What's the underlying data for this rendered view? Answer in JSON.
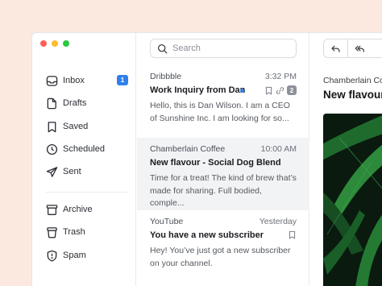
{
  "window_controls": {
    "close_color": "#ff5f57",
    "minimize_color": "#febc2e",
    "maximize_color": "#28c840"
  },
  "sidebar": {
    "items": [
      {
        "label": "Inbox",
        "icon": "inbox-icon",
        "badge": "1"
      },
      {
        "label": "Drafts",
        "icon": "drafts-icon"
      },
      {
        "label": "Saved",
        "icon": "bookmark-icon"
      },
      {
        "label": "Scheduled",
        "icon": "clock-icon"
      },
      {
        "label": "Sent",
        "icon": "send-icon"
      },
      {
        "label": "Archive",
        "icon": "archive-icon"
      },
      {
        "label": "Trash",
        "icon": "trash-icon"
      },
      {
        "label": "Spam",
        "icon": "shield-icon"
      }
    ]
  },
  "search": {
    "placeholder": "Search"
  },
  "messages": [
    {
      "sender": "Dribbble",
      "time": "3:32 PM",
      "subject": "Work Inquiry from Dan",
      "preview": "Hello, this is Dan Wilson. I am a CEO of Sunshine Inc. I am looking for so...",
      "unread": true,
      "attachment_count": "2",
      "icons": [
        "bookmark-icon",
        "link-icon"
      ]
    },
    {
      "sender": "Chamberlain Coffee",
      "time": "10:00 AM",
      "subject": "New flavour - Social Dog Blend",
      "preview": "Time for a treat! The kind of brew that’s made for sharing. Full bodied, comple...",
      "selected": true
    },
    {
      "sender": "YouTube",
      "time": "Yesterday",
      "subject": "You have a new subscriber",
      "preview": "Hey! You’ve just got a new subscriber on your channel.",
      "icons": [
        "bookmark-icon"
      ]
    }
  ],
  "detail": {
    "sender": "Chamberlain Co",
    "subject": "New flavour",
    "toolbar": [
      "reply-icon",
      "reply-all-icon"
    ]
  },
  "colors": {
    "accent": "#2f80ed",
    "background": "#fbe9e0",
    "selected_row": "#f2f3f5"
  }
}
